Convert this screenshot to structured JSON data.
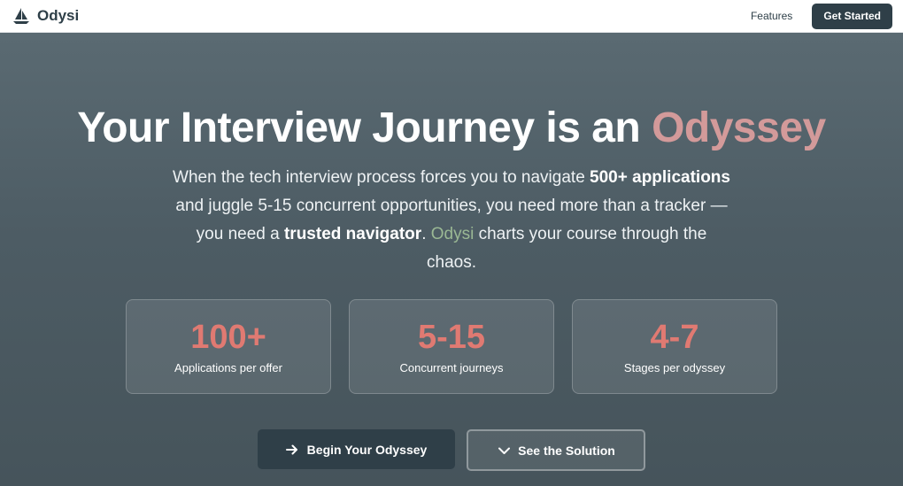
{
  "navbar": {
    "brand_name": "Odysi",
    "brand_icon": "sailboat-icon",
    "features_link": "Features",
    "cta_label": "Get Started"
  },
  "hero": {
    "title_main": "Your Interview Journey is an ",
    "title_accent": "Odyssey",
    "desc": {
      "p1": "When the tech interview process forces you to navigate ",
      "b1": "500+ applications",
      "p2": " and juggle 5-15 concurrent opportunities, you need more than a tracker — you need a ",
      "b2": "trusted navigator",
      "p3": ". ",
      "brand": "Odysi",
      "p4": " charts your course through the chaos."
    },
    "stats": [
      {
        "value": "100+",
        "label": "Applications per offer"
      },
      {
        "value": "5-15",
        "label": "Concurrent journeys"
      },
      {
        "value": "4-7",
        "label": "Stages per odyssey"
      }
    ],
    "primary_button": {
      "label": "Begin Your Odyssey",
      "icon": "arrow-right-icon"
    },
    "secondary_button": {
      "label": "See the Solution",
      "icon": "chevron-down-icon"
    }
  },
  "colors": {
    "navy": "#2f3f48",
    "accent_pink": "#d39a9a",
    "stat_coral": "#e07a72",
    "brand_green": "#9ab894"
  }
}
